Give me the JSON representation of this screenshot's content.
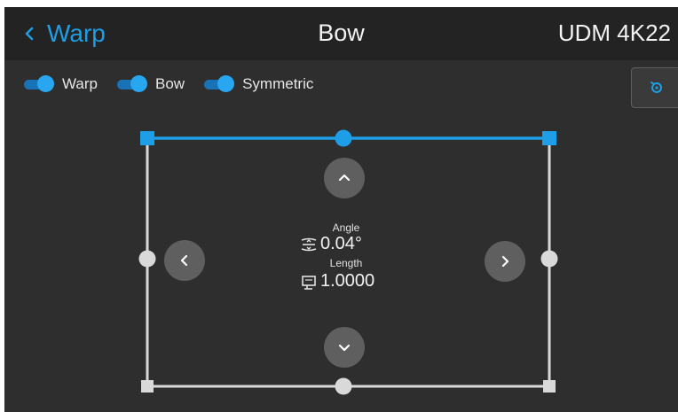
{
  "header": {
    "back_label": "Warp",
    "title": "Bow",
    "device": "UDM 4K22"
  },
  "toggles": [
    {
      "label": "Warp",
      "state": "on"
    },
    {
      "label": "Bow",
      "state": "on"
    },
    {
      "label": "Symmetric",
      "state": "on"
    }
  ],
  "reset": {
    "icon": "reset-icon"
  },
  "readout": {
    "angle_label": "Angle",
    "angle_value": "0.04°",
    "length_label": "Length",
    "length_value": "1.0000"
  },
  "colors": {
    "accent": "#1e9ee6",
    "background": "#2e2e2e",
    "header": "#232323",
    "frame": "#d9d9d9",
    "button": "#5f5f5f"
  }
}
